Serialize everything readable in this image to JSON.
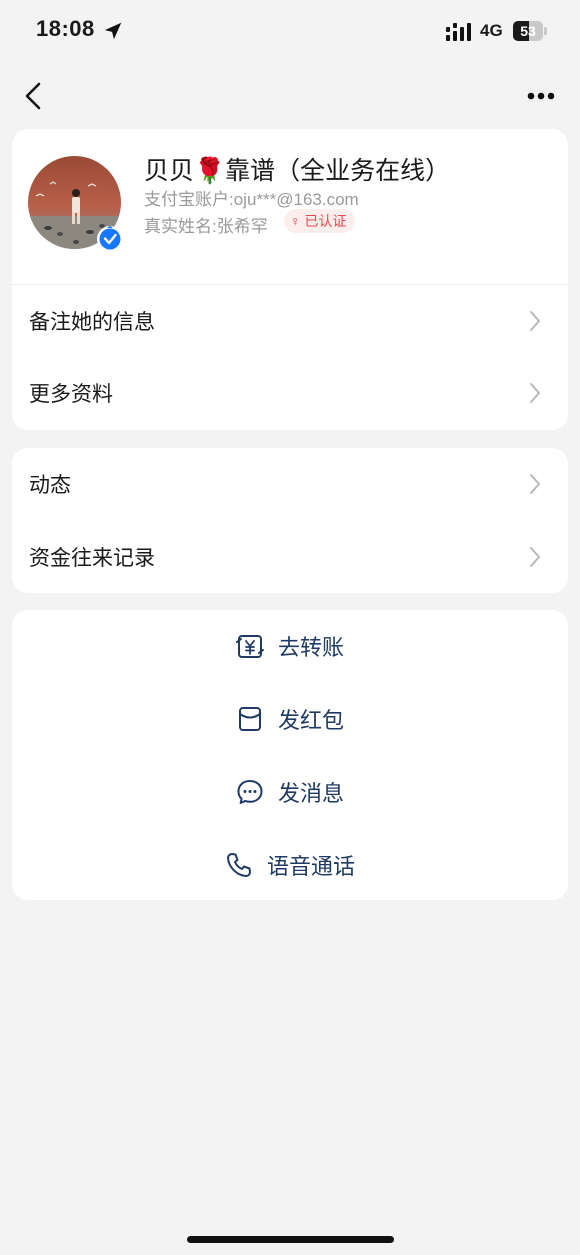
{
  "status_bar": {
    "time": "18:08",
    "network": "4G",
    "battery_text": "53",
    "battery_level": 0.53,
    "location_icon": "location-arrow-icon",
    "signal_icon": "signal-bars-icon"
  },
  "nav": {
    "back_icon": "chevron-left-icon",
    "more_icon": "ellipsis-icon"
  },
  "profile": {
    "name": "贝贝🌹靠谱（全业务在线）",
    "account": "支付宝账户:oju***@163.com",
    "real_name": "真实姓名:张希罕",
    "verified_label": "已认证",
    "gender_icon": "♀",
    "verified_badge_icon": "verified-check-icon"
  },
  "rows_info": [
    {
      "label": "备注她的信息"
    },
    {
      "label": "更多资料"
    }
  ],
  "rows_activity": [
    {
      "label": "动态"
    },
    {
      "label": "资金往来记录"
    }
  ],
  "actions": [
    {
      "label": "去转账",
      "icon": "transfer-yuan-icon"
    },
    {
      "label": "发红包",
      "icon": "red-packet-icon"
    },
    {
      "label": "发消息",
      "icon": "message-bubble-icon"
    },
    {
      "label": "语音通话",
      "icon": "phone-icon"
    }
  ],
  "colors": {
    "background": "#f3f3f3",
    "card": "#ffffff",
    "action_text": "#1f3a63",
    "verified_text": "#e5484d",
    "badge_blue": "#1677ff"
  }
}
